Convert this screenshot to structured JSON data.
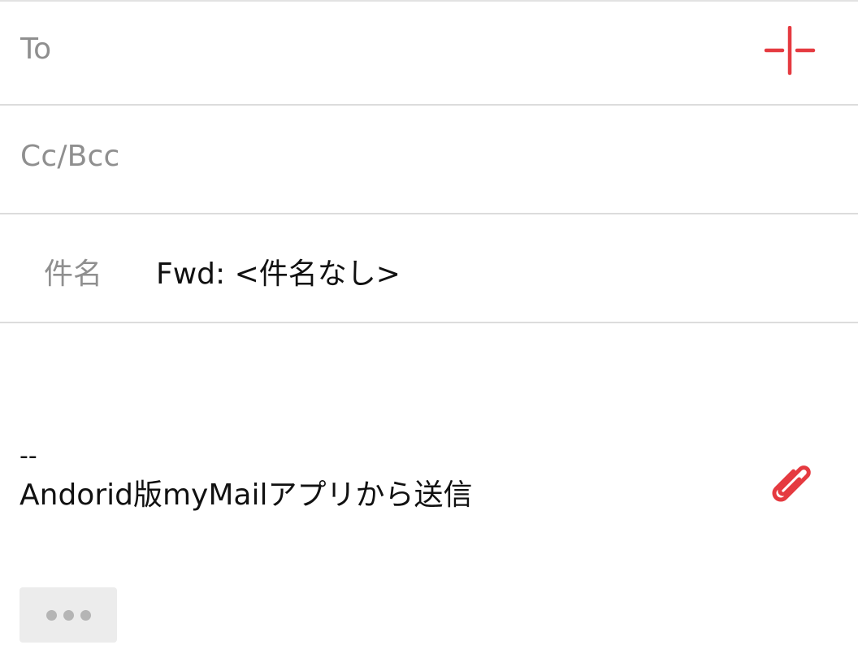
{
  "compose": {
    "to_label": "To",
    "cc_bcc_label": "Cc/Bcc",
    "subject_label": "件名",
    "subject_value": "Fwd: <件名なし>",
    "add_recipient_icon": "plus-icon",
    "attach_icon": "paperclip-icon"
  },
  "body": {
    "signature_separator": "--",
    "signature_text": "Andorid版myMailアプリから送信"
  },
  "more_button": {
    "icon": "ellipsis-icon"
  },
  "colors": {
    "accent": "#e53a40",
    "label": "#8f8f8f",
    "text": "#111111",
    "divider": "#dcdcdc",
    "more_button_bg": "#ececec"
  }
}
